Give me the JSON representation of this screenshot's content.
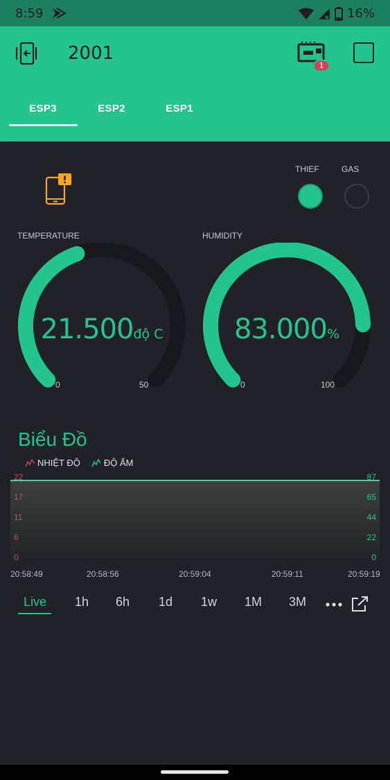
{
  "status_bar": {
    "time": "8:59",
    "battery": "16%"
  },
  "header": {
    "title": "2001",
    "device_badge": "1"
  },
  "tabs": [
    {
      "label": "ESP3"
    },
    {
      "label": "ESP2"
    },
    {
      "label": "ESP1"
    }
  ],
  "leds": [
    {
      "label": "THIEF",
      "state": "on"
    },
    {
      "label": "GAS",
      "state": "off"
    }
  ],
  "gauges": [
    {
      "label": "TEMPERATURE",
      "value": "21.500",
      "unit": "độ C",
      "min": "0",
      "max": "50",
      "level": 0.43
    },
    {
      "label": "HUMIDITY",
      "value": "83.000",
      "unit": "%",
      "min": "0",
      "max": "100",
      "level": 0.83
    }
  ],
  "chart": {
    "title": "Biểu Đồ",
    "legend": [
      {
        "label": "NHIỆT ĐỘ",
        "color": "#d3435c"
      },
      {
        "label": "ĐỘ ẨM",
        "color": "#23c48e"
      }
    ],
    "left_ticks": [
      "22",
      "17",
      "11",
      "6",
      "0"
    ],
    "right_ticks": [
      "87",
      "65",
      "44",
      "22",
      "0"
    ],
    "x_ticks": [
      "20:58:49",
      "20:58:56",
      "20:59:04",
      "20:59:11",
      "20:59:19"
    ]
  },
  "chart_data": {
    "type": "area",
    "x": [
      "20:58:49",
      "20:58:56",
      "20:59:04",
      "20:59:11",
      "20:59:19"
    ],
    "series": [
      {
        "name": "NHIỆT ĐỘ",
        "values": [
          21.5,
          21.5,
          21.5,
          21.5,
          21.5
        ],
        "ylim": [
          0,
          22
        ]
      },
      {
        "name": "ĐỘ ẨM",
        "values": [
          83,
          83,
          83,
          83,
          83
        ],
        "ylim": [
          0,
          87
        ]
      }
    ],
    "title": "Biểu Đồ"
  },
  "ranges": [
    {
      "label": "Live"
    },
    {
      "label": "1h"
    },
    {
      "label": "6h"
    },
    {
      "label": "1d"
    },
    {
      "label": "1w"
    },
    {
      "label": "1M"
    },
    {
      "label": "3M"
    }
  ],
  "colors": {
    "accent": "#23c48e",
    "header": "#23c48e",
    "background": "#212227",
    "alert": "#f5a623",
    "temperature": "#d3435c"
  }
}
